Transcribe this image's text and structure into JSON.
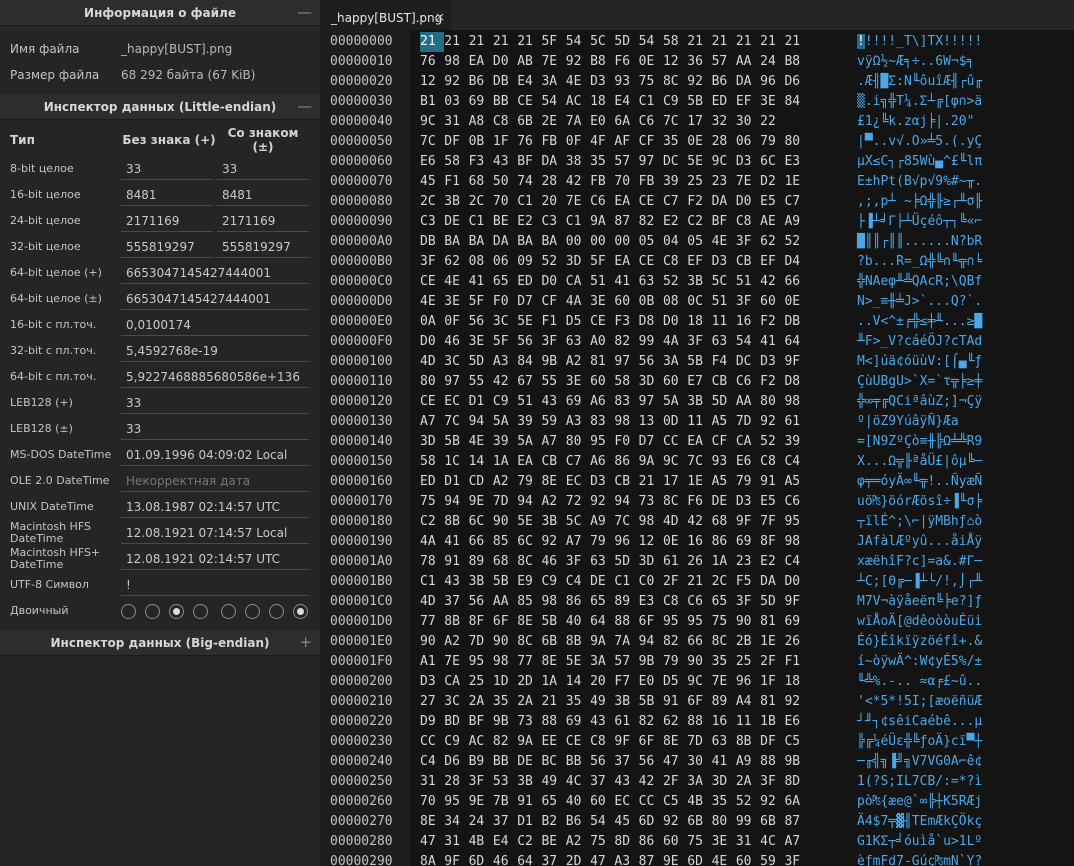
{
  "file_info": {
    "title": "Информация о файле",
    "toggle": "—",
    "rows": [
      {
        "key": "Имя файла",
        "value": "_happy[BUST].png"
      },
      {
        "key": "Размер файла",
        "value": "68 292 байта (67 KiB)"
      }
    ]
  },
  "inspector_le": {
    "title": "Инспектор данных (Little-endian)",
    "toggle": "—",
    "col_type": "Тип",
    "col_unsigned": "Без знака (+)",
    "col_signed": "Со знаком (±)",
    "pairs": [
      {
        "name": "8-bit целое",
        "u": "33",
        "s": "33"
      },
      {
        "name": "16-bit целое",
        "u": "8481",
        "s": "8481"
      },
      {
        "name": "24-bit целое",
        "u": "2171169",
        "s": "2171169"
      },
      {
        "name": "32-bit целое",
        "u": "555819297",
        "s": "555819297"
      }
    ],
    "singles": [
      {
        "name": "64-bit целое (+)",
        "value": "6653047145427444001"
      },
      {
        "name": "64-bit целое (±)",
        "value": "6653047145427444001"
      },
      {
        "name": "16-bit с пл.точ.",
        "value": "0,0100174"
      },
      {
        "name": "32-bit с пл.точ.",
        "value": "5,4592768e-19"
      },
      {
        "name": "64-bit с пл.точ.",
        "value": "5,9227468885680586e+136"
      },
      {
        "name": "LEB128 (+)",
        "value": "33"
      },
      {
        "name": "LEB128 (±)",
        "value": "33"
      },
      {
        "name": "MS-DOS DateTime",
        "value": "01.09.1996 04:09:02 Local"
      },
      {
        "name": "OLE 2.0 DateTime",
        "value": "Некорректная дата"
      },
      {
        "name": "UNIX DateTime",
        "value": "13.08.1987 02:14:57 UTC"
      },
      {
        "name": "Macintosh HFS DateTime",
        "value": "12.08.1921 07:14:57 Local"
      },
      {
        "name": "Macintosh HFS+ DateTime",
        "value": "12.08.1921 02:14:57 UTC"
      },
      {
        "name": "UTF-8 Символ",
        "value": "!"
      }
    ],
    "binary_label": "Двоичный",
    "binary_bits": [
      0,
      0,
      1,
      0,
      0,
      0,
      0,
      1
    ]
  },
  "inspector_be": {
    "title": "Инспектор данных (Big-endian)",
    "toggle": "+"
  },
  "editor": {
    "tab_label": "_happy[BUST].png",
    "close_glyph": "×",
    "rows": [
      {
        "addr": "00000000",
        "hex": "21 21 21 21 21 5F 54 5C 5D 54 58 21 21 21 21 21",
        "ascii": "!!!!!_T\\]TX!!!!!"
      },
      {
        "addr": "00000010",
        "hex": "76 98 EA D0 AB 7E 92 B8 F6 0E 12 36 57 AA 24 B8",
        "ascii": "vÿΩ½~Æ╕÷..6W¬$╕"
      },
      {
        "addr": "00000020",
        "hex": "12 92 B6 DB E4 3A 4E D3 93 75 8C 92 B6 DA 96 D6",
        "ascii": ".Æ╢█Σ:N╙ôuîÆ╢┌û╓"
      },
      {
        "addr": "00000030",
        "hex": "B1 03 69 BB CE 54 AC 18 E4 C1 C9 5B ED EF 3E 84",
        "ascii": "▒.i╗╬T¼.Σ┴╔[φ∩>ä"
      },
      {
        "addr": "00000040",
        "hex": "9C 31 A8 C8 6B 2E 7A E0 6A C6 7C 17 32 30 22",
        "ascii": "£1¿╚k.zαj╞|.20\""
      },
      {
        "addr": "00000050",
        "hex": "7C DF 0B 1F 76 FB 0F 4F AF CF 35 0E 28 06 79 80",
        "ascii": "|▀..v√.O»╧5.(.yÇ"
      },
      {
        "addr": "00000060",
        "hex": "E6 58 F3 43 BF DA 38 35 57 97 DC 5E 9C D3 6C E3",
        "ascii": "µX≤C┐┌85Wù▄^£╙lπ"
      },
      {
        "addr": "00000070",
        "hex": "45 F1 68 50 74 28 42 FB 70 FB 39 25 23 7E D2 1E",
        "ascii": "E±hPt(B√p√9%#~╥."
      },
      {
        "addr": "00000080",
        "hex": "2C 3B 2C 70 C1 20 7E C6 EA CE C7 F2 DA D0 E5 C7",
        "ascii": ",;,p┴ ~╞Ω╬╟≥┌╨σ╟"
      },
      {
        "addr": "00000090",
        "hex": "C3 DE C1 BE E2 C3 C1 9A 87 82 E2 C2 BF C8 AE A9",
        "ascii": "├▐┴╛Γ├┴Üçéô┬┐╚«⌐"
      },
      {
        "addr": "000000A0",
        "hex": "DB BA BA DA BA BA 00 00 00 05 04 05 4E 3F 62 52",
        "ascii": "█║║┌║║......N?bR"
      },
      {
        "addr": "000000B0",
        "hex": "3F 62 08 06 09 52 3D 5F EA CE C8 EF D3 CB EF D4",
        "ascii": "?b...R=_Ω╬╚∩╙╦∩╘"
      },
      {
        "addr": "000000C0",
        "hex": "CE 4E 41 65 ED D0 CA 51 41 63 52 3B 5C 51 42 66",
        "ascii": "╬NAeφ╨╩QAcR;\\QBf"
      },
      {
        "addr": "000000D0",
        "hex": "4E 3E 5F F0 D7 CF 4A 3E 60 0B 08 0C 51 3F 60 0E",
        "ascii": "N>_≡╫╧J>`...Q?`."
      },
      {
        "addr": "000000E0",
        "hex": "0A 0F 56 3C 5E F1 D5 CE F3 D8 D0 18 11 16 F2 DB",
        "ascii": "..V<^±╒╬≤╪╨...≥█"
      },
      {
        "addr": "000000F0",
        "hex": "D0 46 3E 5F 56 3F 63 A0 82 99 4A 3F 63 54 41 64",
        "ascii": "╨F>_V?cáéÖJ?cTAd"
      },
      {
        "addr": "00000100",
        "hex": "4D 3C 5D A3 84 9B A2 81 97 56 3A 5B F4 DC D3 9F",
        "ascii": "M<]úä¢óüùV:[⌠▄╙ƒ"
      },
      {
        "addr": "00000110",
        "hex": "80 97 55 42 67 55 3E 60 58 3D 60 E7 CB C6 F2 D8",
        "ascii": "ÇùUBgU>`X=`τ╦╞≥╪"
      },
      {
        "addr": "00000120",
        "hex": "CE EC D1 C9 51 43 69 A6 83 97 5A 3B 5D AA 80 98",
        "ascii": "╬∞╤╔QCiªâùZ;]¬Çÿ"
      },
      {
        "addr": "00000130",
        "hex": "A7 7C 94 5A 39 59 A3 83 98 13 0D 11 A5 7D 92 61",
        "ascii": "º|öZ9YúâÿÑ}Æa"
      },
      {
        "addr": "00000140",
        "hex": "3D 5B 4E 39 5A A7 80 95 F0 D7 CC EA CF CA 52 39",
        "ascii": "=[N9ZºÇò≡╫╠Ω╧╩R9"
      },
      {
        "addr": "00000150",
        "hex": "58 1C 14 1A EA CB C7 A6 86 9A 9C 7C 93 E6 C8 C4",
        "ascii": "X...Ω╦╟ªåÜ£|ôµ╚─"
      },
      {
        "addr": "00000160",
        "hex": "ED D1 CD A2 79 8E EC D3 CB 21 17 1E A5 79 91 A5",
        "ascii": "φ╤═óyÄ∞╙╦!..ÑyæÑ"
      },
      {
        "addr": "00000170",
        "hex": "75 94 9E 7D 94 A2 72 92 94 73 8C F6 DE D3 E5 C6",
        "ascii": "uö₧}öórÆösî÷▐╙σ╞"
      },
      {
        "addr": "00000180",
        "hex": "C2 8B 6C 90 5E 3B 5C A9 7C 98 4D 42 68 9F 7F 95",
        "ascii": "┬ïlÉ^;\\⌐|ÿMBhƒ⌂ò"
      },
      {
        "addr": "00000190",
        "hex": "4A 41 66 85 6C 92 A7 79 96 12 0E 16 86 69 8F 98",
        "ascii": "JAfàlÆºyû...åiÅÿ"
      },
      {
        "addr": "000001A0",
        "hex": "78 91 89 68 8C 46 3F 63 5D 3D 61 26 1A 23 E2 C4",
        "ascii": "xæëhîF?c]=a&.#Γ─"
      },
      {
        "addr": "000001B0",
        "hex": "C1 43 3B 5B E9 C9 C4 DE C1 C0 2F 21 2C F5 DA D0",
        "ascii": "┴C;[Θ╔─▐┴└/!,⌡┌╨"
      },
      {
        "addr": "000001C0",
        "hex": "4D 37 56 AA 85 98 86 65 89 E3 C8 C6 65 3F 5D 9F",
        "ascii": "M7V¬àÿåeëπ╚╞e?]ƒ"
      },
      {
        "addr": "000001D0",
        "hex": "77 8B 8F 6F 8E 5B 40 64 88 6F 95 95 75 90 81 69",
        "ascii": "wïÅoÄ[@dêoòòuÉüi"
      },
      {
        "addr": "000001E0",
        "hex": "90 A2 7D 90 8C 6B 8B 9A 7A 94 82 66 8C 2B 1E 26",
        "ascii": "Éó}Éîkïÿzöéfî+.&"
      },
      {
        "addr": "000001F0",
        "hex": "A1 7E 95 98 77 8E 5E 3A 57 9B 79 90 35 25 2F F1",
        "ascii": "í~òÿwÄ^:W¢yÉ5%/±"
      },
      {
        "addr": "00000200",
        "hex": "D3 CA 25 1D 2D 1A 14 20 F7 E0 D5 9C 7E 96 1F 18",
        "ascii": "╙╩%.-.. ≈α╒£~û.."
      },
      {
        "addr": "00000210",
        "hex": "27 3C 2A 35 2A 21 35 49 3B 5B 91 6F 89 A4 81 92",
        "ascii": "'<*5*!5I;[æoëñüÆ"
      },
      {
        "addr": "00000220",
        "hex": "D9 BD BF 9B 73 88 69 43 61 82 62 88 16 11 1B E6",
        "ascii": "┘╜┐¢sêiCaébê...µ"
      },
      {
        "addr": "00000230",
        "hex": "CC C9 AC 82 9A EE CE C8 9F 6F 8E 7D 63 8B DF C5",
        "ascii": "╠╔¼éÜε╬╚ƒoÄ}cï▀┼"
      },
      {
        "addr": "00000240",
        "hex": "C4 D6 B9 BB DE BC BB 56 37 56 47 30 41 A9 88 9B",
        "ascii": "─╓╣╗▐╝╗V7VG0A⌐ê¢"
      },
      {
        "addr": "00000250",
        "hex": "31 28 3F 53 3B 49 4C 37 43 42 2F 3A 3D 2A 3F 8D",
        "ascii": "1(?S;IL7CB/:=*?ì"
      },
      {
        "addr": "00000260",
        "hex": "70 95 9E 7B 91 65 40 60 EC CC C5 4B 35 52 92 6A",
        "ascii": "pò₧{æe@`∞╠┼K5RÆj"
      },
      {
        "addr": "00000270",
        "hex": "8E 34 24 37 D1 B2 B6 54 45 6D 92 6B 80 99 6B 87",
        "ascii": "Ä4$7╤▓╢TEmÆkÇÖkç"
      },
      {
        "addr": "00000280",
        "hex": "47 31 4B E4 C2 BE A2 75 8D 86 60 75 3E 31 4C A7",
        "ascii": "G1KΣ┬╛óuìå`u>1Lº"
      },
      {
        "addr": "00000290",
        "hex": "8A 9F 6D 46 64 37 2D 47 A3 87 9E 6D 4E 60 59 3F",
        "ascii": "èƒmFd7-Gúç₧mN`Y?"
      }
    ]
  }
}
